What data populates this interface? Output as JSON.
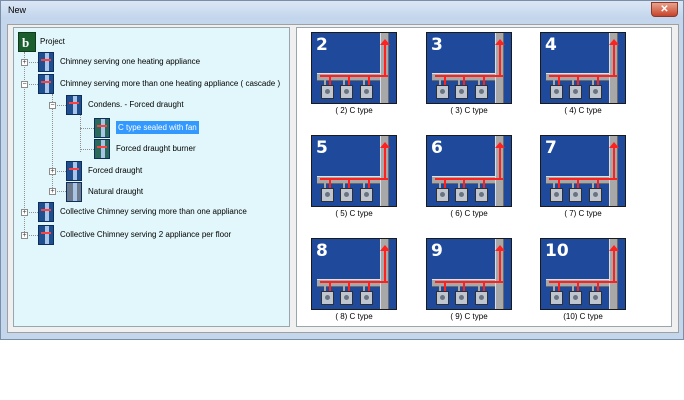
{
  "window": {
    "title": "New",
    "close_glyph": "✕"
  },
  "tree": {
    "root": {
      "label": "Project",
      "icon": "project-logo-icon",
      "glyph": "b"
    },
    "nodes": [
      {
        "id": "chimney-single",
        "label": "Chimney  serving one heating appliance",
        "level": 1,
        "expander": "+"
      },
      {
        "id": "chimney-cascade",
        "label": "Chimney serving more than one heating appliance ( cascade )",
        "level": 1,
        "expander": "−"
      },
      {
        "id": "condens-forced",
        "label": "Condens. - Forced draught",
        "level": 2,
        "expander": "−"
      },
      {
        "id": "c-type-sealed",
        "label": "C type sealed with fan",
        "level": 3,
        "selected": true
      },
      {
        "id": "forced-burner",
        "label": "Forced draught burner",
        "level": 3
      },
      {
        "id": "forced-draught",
        "label": "Forced draught",
        "level": 2,
        "expander": "+"
      },
      {
        "id": "natural-draught",
        "label": "Natural draught",
        "level": 2,
        "expander": "+"
      },
      {
        "id": "collective-multi",
        "label": "Collective  Chimney serving more than one appliance",
        "level": 1,
        "expander": "+"
      },
      {
        "id": "collective-floor",
        "label": "Collective Chimney serving 2 appliance per floor",
        "level": 1,
        "expander": "+"
      }
    ]
  },
  "thumbnails": [
    {
      "number": "2",
      "caption": "( 2) C type"
    },
    {
      "number": "3",
      "caption": "( 3) C type"
    },
    {
      "number": "4",
      "caption": "( 4) C type"
    },
    {
      "number": "5",
      "caption": "( 5) C type"
    },
    {
      "number": "6",
      "caption": "( 6) C type"
    },
    {
      "number": "7",
      "caption": "( 7) C type"
    },
    {
      "number": "8",
      "caption": "( 8) C type"
    },
    {
      "number": "9",
      "caption": "( 9) C type"
    },
    {
      "number": "10",
      "caption": "(10) C type"
    }
  ],
  "colors": {
    "thumb_bg": "#1f4a9c",
    "flow": "#ff2020",
    "selection": "#3399ff",
    "tree_bg": "#e2f7fb"
  }
}
